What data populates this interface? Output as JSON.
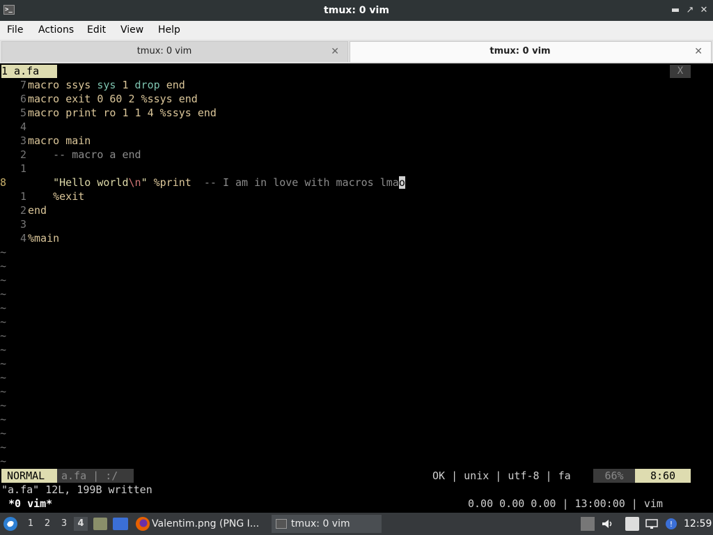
{
  "window": {
    "title": "tmux: 0 vim"
  },
  "menu": [
    "File",
    "Actions",
    "Edit",
    "View",
    "Help"
  ],
  "tabs": [
    {
      "label": "tmux: 0 vim",
      "active": false
    },
    {
      "label": "tmux: 0 vim",
      "active": true
    }
  ],
  "vim": {
    "buffer_tab": "1 a.fa",
    "buffer_close": "X",
    "lines": [
      {
        "n": "7",
        "tokens": [
          [
            "kw",
            "macro "
          ],
          [
            "id",
            "ssys "
          ],
          [
            "call",
            "sys "
          ],
          [
            "num",
            "1 "
          ],
          [
            "call",
            "drop "
          ],
          [
            "kw",
            "end"
          ]
        ]
      },
      {
        "n": "6",
        "tokens": [
          [
            "kw",
            "macro "
          ],
          [
            "id",
            "exit "
          ],
          [
            "num",
            "0 60 2 "
          ],
          [
            "id",
            "%ssys "
          ],
          [
            "kw",
            "end"
          ]
        ]
      },
      {
        "n": "5",
        "tokens": [
          [
            "kw",
            "macro "
          ],
          [
            "id",
            "print "
          ],
          [
            "id",
            "ro "
          ],
          [
            "num",
            "1 1 4 "
          ],
          [
            "id",
            "%ssys "
          ],
          [
            "kw",
            "end"
          ]
        ]
      },
      {
        "n": "4",
        "tokens": []
      },
      {
        "n": "3",
        "tokens": [
          [
            "kw",
            "macro "
          ],
          [
            "id",
            "main"
          ]
        ]
      },
      {
        "n": "2",
        "tokens": [
          [
            "cmt",
            "    -- macro a end"
          ]
        ]
      },
      {
        "n": "1",
        "tokens": []
      },
      {
        "n": "8",
        "current": true,
        "tokens": [
          [
            "str",
            "    \"Hello world"
          ],
          [
            "esc",
            "\\n"
          ],
          [
            "str",
            "\" "
          ],
          [
            "id",
            "%print  "
          ],
          [
            "cmt",
            "-- I am in love with macros lma"
          ],
          [
            "cursor",
            "o"
          ]
        ]
      },
      {
        "n": "1",
        "tokens": [
          [
            "id",
            "    %exit"
          ]
        ]
      },
      {
        "n": "2",
        "tokens": [
          [
            "kw",
            "end"
          ]
        ]
      },
      {
        "n": "3",
        "tokens": []
      },
      {
        "n": "4",
        "tokens": [
          [
            "id",
            "%main"
          ]
        ]
      }
    ],
    "tilde": "~",
    "status": {
      "mode": "NORMAL",
      "file": "a.fa | :/",
      "info": "OK | unix | utf-8 | fa",
      "percent": "66%",
      "position": "8:60"
    },
    "message": "\"a.fa\" 12L, 199B written"
  },
  "tmux": {
    "window": "*0 vim*",
    "right": "0.00 0.00 0.00 | 13:00:00 | vim"
  },
  "taskbar": {
    "workspaces": [
      "1",
      "2",
      "3",
      "4"
    ],
    "active_workspace": "4",
    "tasks": [
      "Valentim.png (PNG I...",
      "tmux: 0 vim"
    ],
    "clock": "12:59"
  },
  "colors": {
    "status_mode_bg": "#dedcb0",
    "status_file_bg": "#3a3a3a",
    "status_file_fg": "#8a8a8a",
    "cursor_line_number": "#c8b06a",
    "panel_bg": "#36393c"
  },
  "icons": [
    "terminal-icon",
    "minimize-icon",
    "maximize-icon",
    "close-icon",
    "start-menu-icon",
    "file-manager-icon",
    "firefox-icon",
    "volume-icon",
    "clipboard-icon",
    "network-icon"
  ]
}
